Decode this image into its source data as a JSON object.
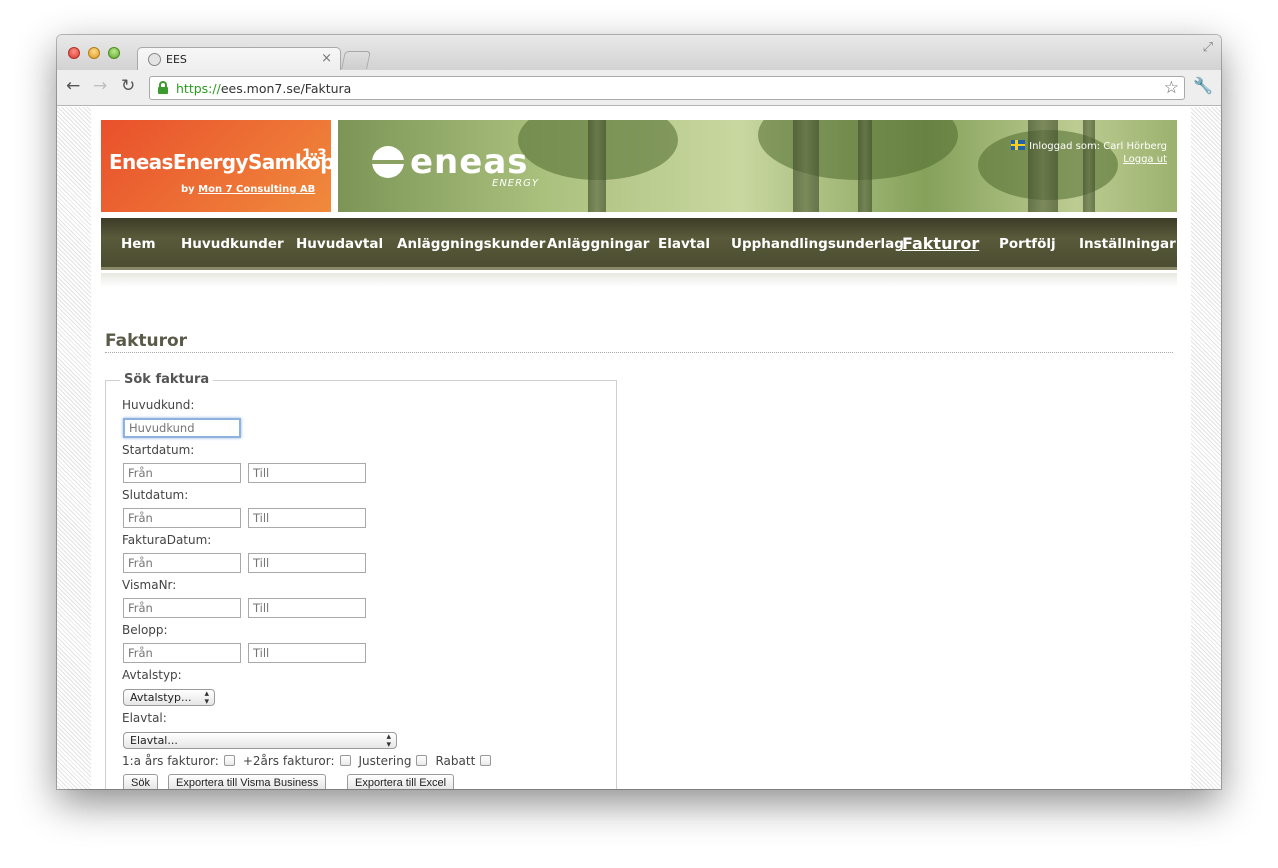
{
  "browser": {
    "tab_title": "EES",
    "url_scheme": "https://",
    "url_host": "ees.mon7.se",
    "url_path": "/Faktura"
  },
  "header": {
    "logo_title": "EneasEnergySamköp",
    "logo_version": "1.3",
    "logo_by": "by",
    "logo_company": "Mon 7 Consulting AB",
    "brand_word": "eneas",
    "brand_sub": "ENERGY",
    "logged_in_label": "Inloggad som: Carl Hörberg",
    "logout_label": "Logga ut"
  },
  "nav": {
    "items": [
      {
        "label": "Hem"
      },
      {
        "label": "Huvudkunder"
      },
      {
        "label": "Huvudavtal"
      },
      {
        "label": "Anläggningskunder"
      },
      {
        "label": "Anläggningar"
      },
      {
        "label": "Elavtal"
      },
      {
        "label": "Upphandlingsunderlag"
      },
      {
        "label": "Fakturor"
      },
      {
        "label": "Portfölj"
      },
      {
        "label": "Inställningar"
      }
    ],
    "active": "Fakturor"
  },
  "main": {
    "title": "Fakturor",
    "form": {
      "legend": "Sök faktura",
      "huvudkund_label": "Huvudkund:",
      "huvudkund_placeholder": "Huvudkund",
      "startdatum_label": "Startdatum:",
      "slutdatum_label": "Slutdatum:",
      "fakturadatum_label": "FakturaDatum:",
      "vismanr_label": "VismaNr:",
      "belopp_label": "Belopp:",
      "from_placeholder": "Från",
      "to_placeholder": "Till",
      "avtalstyp_label": "Avtalstyp:",
      "avtalstyp_value": "Avtalstyp...",
      "elavtal_label": "Elavtal:",
      "elavtal_value": "Elavtal...",
      "chk_1ar": "1:a års fakturor:",
      "chk_2ar": "+2års fakturor:",
      "chk_justering": "Justering",
      "chk_rabatt": "Rabatt",
      "btn_search": "Sök",
      "btn_export_visma": "Exportera till Visma Business",
      "btn_export_excel": "Exportera till Excel"
    }
  },
  "colors": {
    "logo_bg": "#eb5f30",
    "nav_bg": "#4c4d31",
    "secure_green": "#2a9d1e"
  }
}
